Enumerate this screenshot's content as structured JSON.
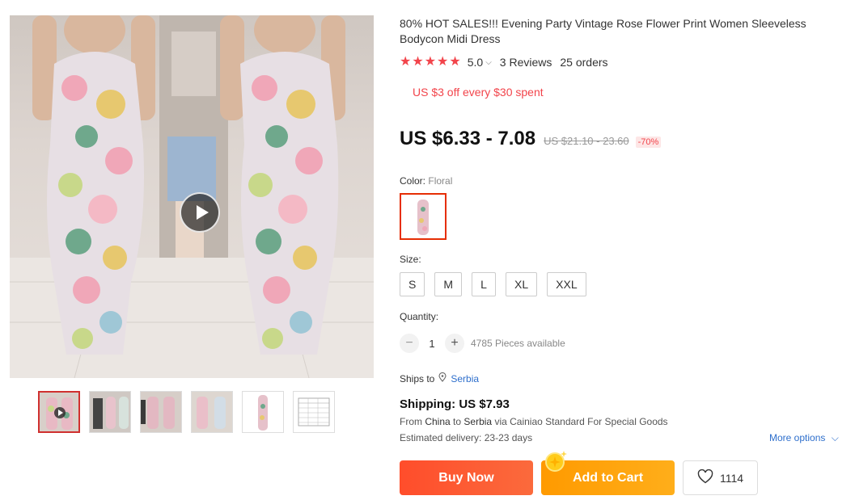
{
  "product": {
    "title": "80% HOT SALES!!! Evening Party Vintage Rose Flower Print Women Sleeveless Bodycon Midi Dress",
    "rating": {
      "stars": 5,
      "value": "5.0",
      "reviews": "3 Reviews",
      "orders": "25 orders"
    },
    "promo": "US $3 off every $30 spent",
    "price": {
      "current": "US $6.33 - 7.08",
      "original": "US $21.10 - 23.60",
      "discount": "-70%"
    }
  },
  "gallery": {
    "thumbnail_count": 6,
    "active_thumbnail": 1
  },
  "options": {
    "color_label": "Color:",
    "color_value": "Floral",
    "size_label": "Size:",
    "sizes": [
      "S",
      "M",
      "L",
      "XL",
      "XXL"
    ],
    "quantity_label": "Quantity:",
    "quantity": "1",
    "quantity_minus": "−",
    "quantity_plus": "+",
    "available": "4785 Pieces available"
  },
  "shipping": {
    "ships_to_label": "Ships to",
    "country": "Serbia",
    "title": "Shipping: US $7.93",
    "from_prefix": "From",
    "from_country": "China",
    "to_word": "to",
    "to_country": "Serbia",
    "via": "via Cainiao Standard For Special Goods",
    "delivery_label": "Estimated delivery:",
    "delivery_value": "23-23 days",
    "more_options": "More options"
  },
  "actions": {
    "buy_now": "Buy Now",
    "add_to_cart": "Add to Cart",
    "wishlist_count": "1114"
  },
  "colors": {
    "accent_red": "#f2444b",
    "buy_now": "#ff4d2b",
    "add_to_cart": "#ff9a00",
    "link": "#2e6fcc"
  }
}
